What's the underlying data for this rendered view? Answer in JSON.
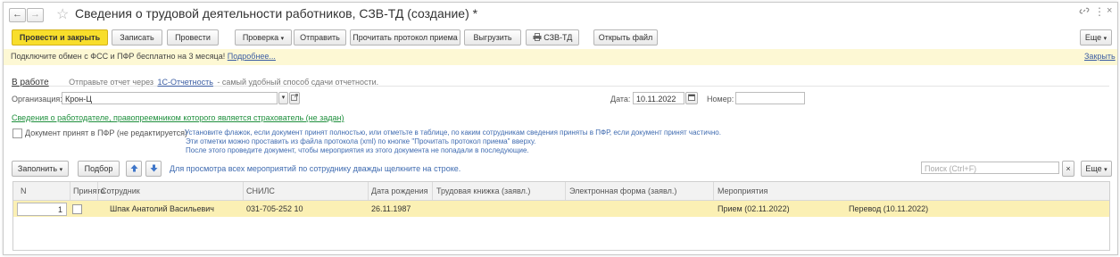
{
  "window": {
    "title": "Сведения о трудовой деятельности работников, СЗВ-ТД (создание) *",
    "back_icon": "←",
    "forward_icon": "→",
    "star_icon": "☆",
    "link_icon": "🔗",
    "menu_icon": "⋮",
    "close_icon": "×"
  },
  "toolbar": {
    "post_close": "Провести и закрыть",
    "save": "Записать",
    "post": "Провести",
    "check": "Проверка",
    "send": "Отправить",
    "read_protocol": "Прочитать протокол приема",
    "export": "Выгрузить",
    "print": "СЗВ-ТД",
    "open_file": "Открыть файл",
    "more": "Еще"
  },
  "infobar": {
    "text": "Подключите обмен с ФСС и ПФР бесплатно на 3 месяца!",
    "more_link": "Подробнее...",
    "close": "Закрыть"
  },
  "status": {
    "link": "В работе",
    "text_before": "Отправьте отчет через",
    "service_link": "1С-Отчетность",
    "text_after": " - самый удобный способ сдачи отчетности."
  },
  "form": {
    "org_label": "Организация:",
    "org_value": "Крон-Ц",
    "date_label": "Дата:",
    "date_value": "10.11.2022",
    "number_label": "Номер:",
    "number_value": "",
    "employer_link": "Сведения о работодателе, правопреемником которого является страхователь (не задан)",
    "accepted_label": "Документ принят в ПФР (не редактируется)",
    "hint_line1": "Установите флажок, если документ принят полностью, или отметьте в таблице, по каким сотрудникам сведения приняты в ПФР, если документ принят частично.",
    "hint_line2": "Эти отметки можно проставить из файла протокола (xml) по кнопке \"Прочитать протокол приема\" вверху.",
    "hint_line3": "После этого проведите документ, чтобы мероприятия из этого документа не попадали в последующие."
  },
  "table_toolbar": {
    "fill": "Заполнить",
    "select": "Подбор",
    "hint": "Для просмотра всех мероприятий по сотруднику дважды щелкните на строке.",
    "search_placeholder": "Поиск (Ctrl+F)",
    "more": "Еще"
  },
  "table": {
    "columns": [
      "N",
      "Принято",
      "Сотрудник",
      "СНИЛС",
      "Дата рождения",
      "Трудовая книжка (заявл.)",
      "Электронная форма (заявл.)",
      "Мероприятия"
    ],
    "rows": [
      {
        "n": "1",
        "employee": "Шпак Анатолий Васильевич",
        "snils": "031-705-252 10",
        "birth": "26.11.1987",
        "event1": "Прием (02.11.2022)",
        "event2": "Перевод (10.11.2022)"
      }
    ]
  },
  "colors": {
    "primary_button": "#f8de2b",
    "infobar": "#fdf8d4",
    "selected_row": "#fbf0b4",
    "link": "#3b5da3",
    "green_link": "#1e8f3c",
    "hint_text": "#3f6bb0"
  }
}
